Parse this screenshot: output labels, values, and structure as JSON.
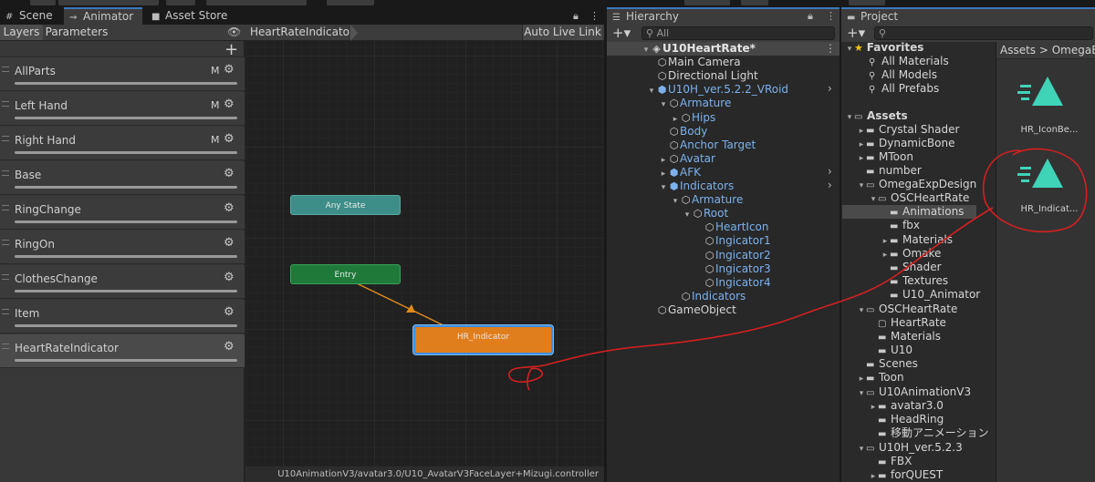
{
  "tabs": {
    "scene": "Scene",
    "animator": "Animator",
    "asset_store": "Asset Store",
    "hierarchy": "Hierarchy",
    "project": "Project"
  },
  "animator": {
    "layers_tab": "Layers",
    "parameters_tab": "Parameters",
    "breadcrumb": "HeartRateIndicator",
    "auto_live_link": "Auto Live Link",
    "layers": [
      {
        "name": "AllParts",
        "m": "M"
      },
      {
        "name": "Left Hand",
        "m": "M"
      },
      {
        "name": "Right Hand",
        "m": "M"
      },
      {
        "name": "Base",
        "m": ""
      },
      {
        "name": "RingChange",
        "m": ""
      },
      {
        "name": "RingOn",
        "m": ""
      },
      {
        "name": "ClothesChange",
        "m": ""
      },
      {
        "name": "Item",
        "m": ""
      },
      {
        "name": "HeartRateIndicator",
        "m": ""
      }
    ],
    "nodes": {
      "any_state": "Any State",
      "entry": "Entry",
      "hr_indicator": "HR_Indicator"
    },
    "status_path": "U10AnimationV3/avatar3.0/U10_AvatarV3FaceLayer+Mizugi.controller"
  },
  "hierarchy": {
    "search_placeholder": "All",
    "items": [
      {
        "label": "U10HeartRate*",
        "color": "white"
      },
      {
        "label": "Main Camera",
        "color": "white"
      },
      {
        "label": "Directional Light",
        "color": "white"
      },
      {
        "label": "U10H_ver.5.2.2_VRoid",
        "color": "blue"
      },
      {
        "label": "Armature",
        "color": "blue"
      },
      {
        "label": "Hips",
        "color": "blue"
      },
      {
        "label": "Body",
        "color": "blue"
      },
      {
        "label": "Anchor Target",
        "color": "blue"
      },
      {
        "label": "Avatar",
        "color": "blue"
      },
      {
        "label": "AFK",
        "color": "blue"
      },
      {
        "label": "Indicators",
        "color": "blue"
      },
      {
        "label": "Armature",
        "color": "blue"
      },
      {
        "label": "Root",
        "color": "blue"
      },
      {
        "label": "HeartIcon",
        "color": "blue"
      },
      {
        "label": "Ingicator1",
        "color": "blue"
      },
      {
        "label": "Ingicator2",
        "color": "blue"
      },
      {
        "label": "Ingicator3",
        "color": "blue"
      },
      {
        "label": "Ingicator4",
        "color": "blue"
      },
      {
        "label": "Indicators",
        "color": "blue"
      },
      {
        "label": "GameObject",
        "color": "white"
      }
    ]
  },
  "project": {
    "breadcrumb": "Assets > OmegaEx",
    "favorites_label": "Favorites",
    "tree": [
      "All Materials",
      "All Models",
      "All Prefabs",
      "Assets",
      "Crystal Shader",
      "DynamicBone",
      "MToon",
      "number",
      "OmegaExpDesign",
      "OSCHeartRate",
      "Animations",
      "fbx",
      "Materials",
      "Omake",
      "Shader",
      "Textures",
      "U10_Animator",
      "OSCHeartRate",
      "HeartRate",
      "Materials",
      "U10",
      "Scenes",
      "Toon",
      "U10AnimationV3",
      "avatar3.0",
      "HeadRing",
      "移動アニメーション",
      "U10H_ver.5.2.3",
      "FBX",
      "forQUEST"
    ],
    "assets": [
      {
        "name": "HR_IconBe..."
      },
      {
        "name": "HR_Indicat..."
      }
    ]
  },
  "colors": {
    "accent": "#3a79bb",
    "any_state": "#3c8a84",
    "entry": "#1e7b3a",
    "hr_indicator": "#e07e1d",
    "annotation": "#d42020",
    "asset_icon": "#3fd3b8"
  }
}
